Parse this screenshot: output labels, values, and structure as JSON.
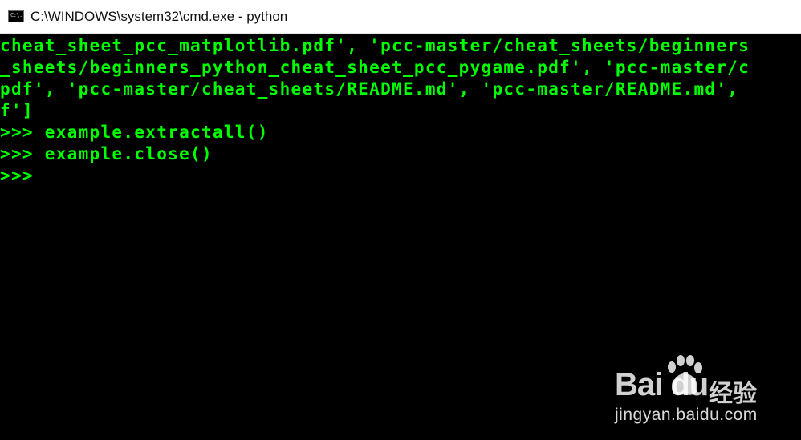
{
  "window": {
    "title": "C:\\WINDOWS\\system32\\cmd.exe - python",
    "icon": "cmd-console-icon",
    "icon_glyph": "C:\\."
  },
  "console": {
    "text_color": "#00ff00",
    "background": "#000000",
    "lines": [
      "cheat_sheet_pcc_matplotlib.pdf', 'pcc-master/cheat_sheets/beginners",
      "_sheets/beginners_python_cheat_sheet_pcc_pygame.pdf', 'pcc-master/c",
      "pdf', 'pcc-master/cheat_sheets/README.md', 'pcc-master/README.md', ",
      "f']",
      ">>> example.extractall()",
      ">>> example.close()",
      ">>>"
    ]
  },
  "watermark": {
    "logo_text": "Bai du",
    "chinese_text": "经验",
    "url": "jingyan.baidu.com"
  }
}
